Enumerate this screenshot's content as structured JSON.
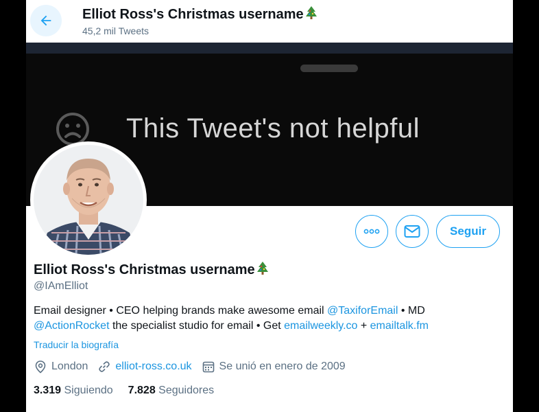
{
  "header": {
    "title": "Elliot Ross's Christmas username",
    "tweet_count": "45,2 mil Tweets"
  },
  "banner": {
    "text": "This Tweet's not helpful"
  },
  "actions": {
    "more_icon": "more-horizontal-icon",
    "message_icon": "envelope-icon",
    "follow_label": "Seguir"
  },
  "profile": {
    "name": "Elliot Ross's Christmas username",
    "handle": "@IAmElliot",
    "bio": {
      "part1": "Email designer • CEO helping brands make awesome email ",
      "mention1": "@TaxiforEmail",
      "part2": " • MD ",
      "mention2": "@ActionRocket",
      "part3": " the specialist studio for email • Get ",
      "link1": "emailweekly.co",
      "part4": " + ",
      "link2": "emailtalk.fm"
    },
    "translate_label": "Traducir la biografía",
    "location": "London",
    "website": "elliot-ross.co.uk",
    "joined": "Se unió en enero de 2009",
    "following_count": "3.319",
    "following_label": "Siguiendo",
    "followers_count": "7.828",
    "followers_label": "Seguidores"
  },
  "colors": {
    "accent": "#1da1f2",
    "link": "#1b95e0",
    "secondary_text": "#5b7083"
  }
}
